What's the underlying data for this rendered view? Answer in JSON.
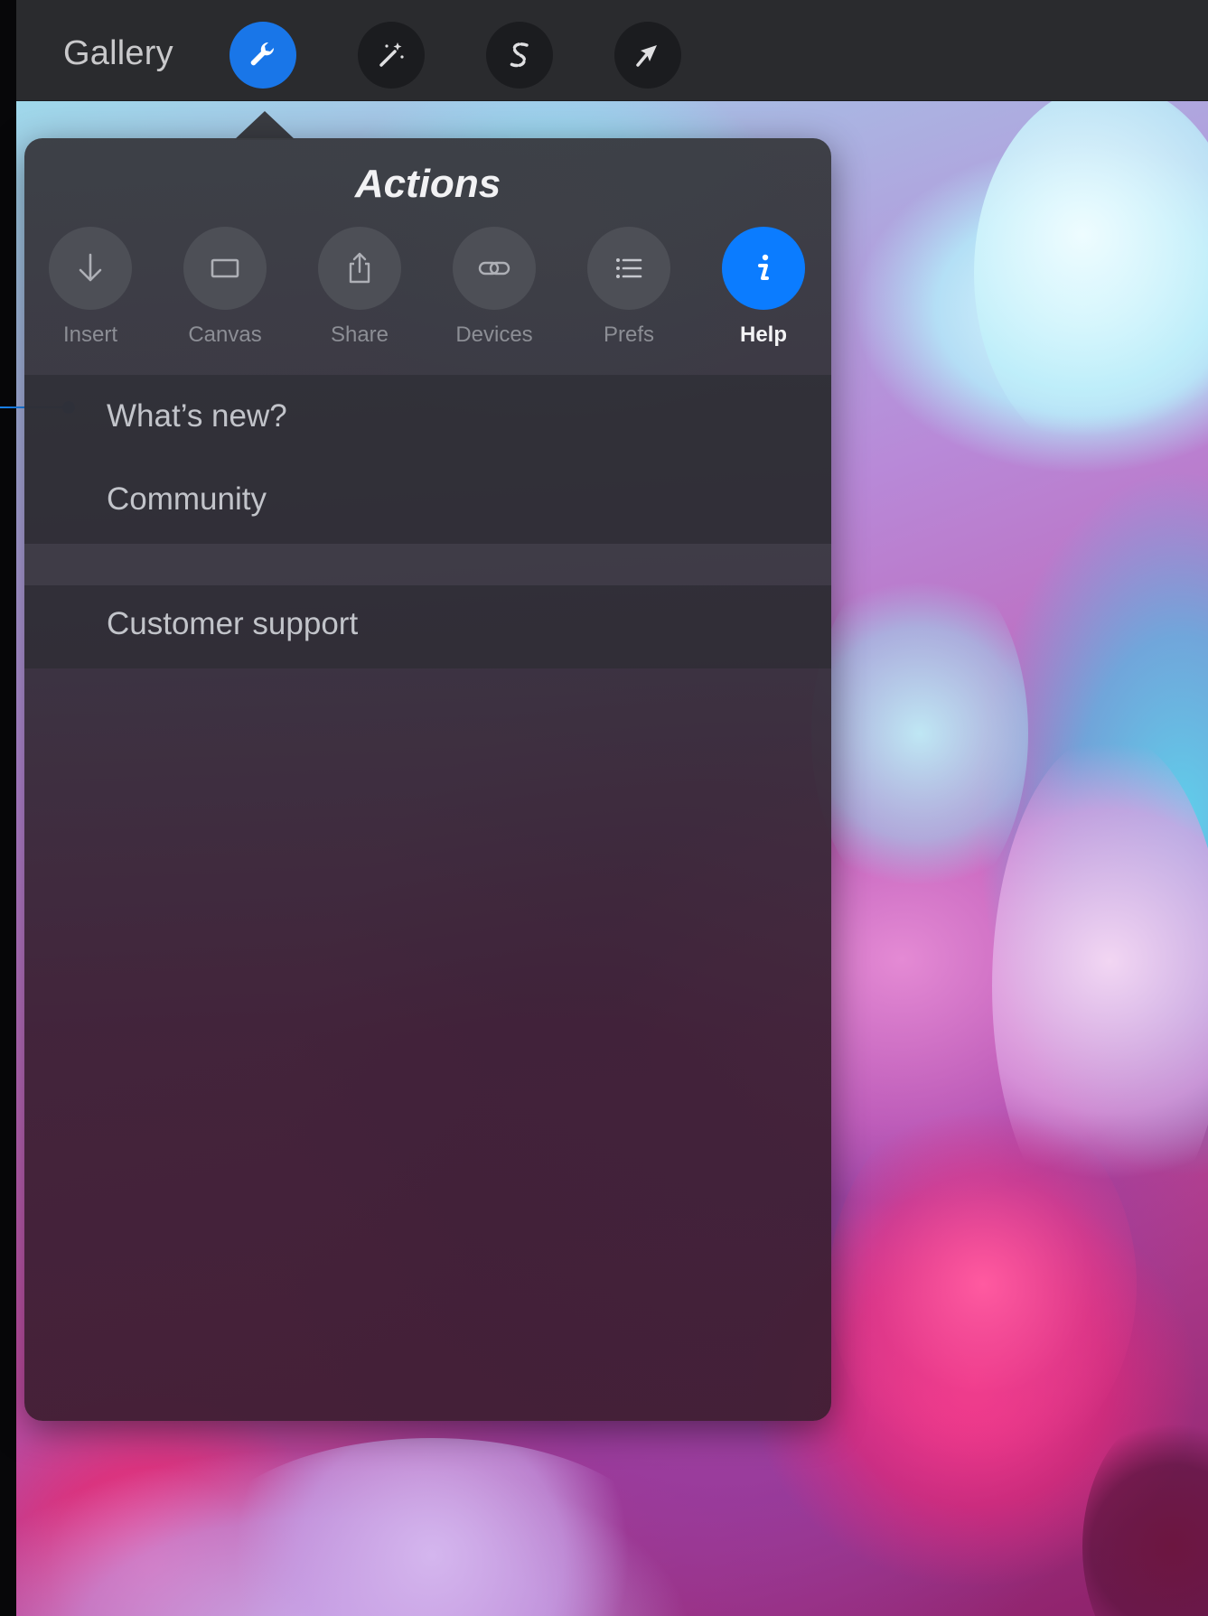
{
  "toolbar": {
    "gallery_label": "Gallery",
    "tools": [
      {
        "icon": "wrench-icon",
        "active": true
      },
      {
        "icon": "magic-wand-icon",
        "active": false
      },
      {
        "icon": "selection-s-icon",
        "active": false
      },
      {
        "icon": "transform-arrow-icon",
        "active": false
      }
    ],
    "accent_color": "#1976e8"
  },
  "actions_popover": {
    "title": "Actions",
    "tabs": [
      {
        "label": "Insert",
        "icon": "arrow-down-icon"
      },
      {
        "label": "Canvas",
        "icon": "rectangle-icon"
      },
      {
        "label": "Share",
        "icon": "share-icon"
      },
      {
        "label": "Devices",
        "icon": "link-icon"
      },
      {
        "label": "Prefs",
        "icon": "list-icon"
      },
      {
        "label": "Help",
        "icon": "info-icon",
        "selected": true
      }
    ],
    "menu": {
      "group1": [
        "What’s new?",
        "Community"
      ],
      "group2": [
        "Customer support"
      ]
    },
    "selected_color": "#0b7cff"
  }
}
